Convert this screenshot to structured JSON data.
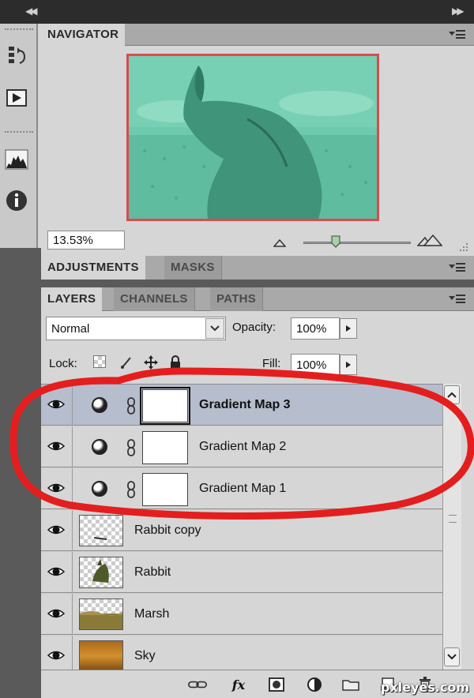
{
  "colors": {
    "preview_fill": "#6ec9ad",
    "preview_border": "#d84c4c",
    "selected_row": "#b6bdcc",
    "annotation": "#e41e1e"
  },
  "topbar": {
    "collapse_left_icon": "double-chevron-left-icon",
    "collapse_right_icon": "double-chevron-right-icon"
  },
  "navigator": {
    "tab": "NAVIGATOR",
    "zoom_value": "13.53%",
    "zoom_level": 0.35
  },
  "adjustments": {
    "tabs": [
      "ADJUSTMENTS",
      "MASKS"
    ]
  },
  "layers_panel": {
    "tabs": [
      "LAYERS",
      "CHANNELS",
      "PATHS"
    ],
    "blend_mode": "Normal",
    "opacity_label": "Opacity:",
    "opacity_value": "100%",
    "lock_label": "Lock:",
    "fill_label": "Fill:",
    "fill_value": "100%",
    "layers": [
      {
        "name": "Gradient Map 3",
        "type": "adjustment",
        "selected": true
      },
      {
        "name": "Gradient Map 2",
        "type": "adjustment",
        "selected": false
      },
      {
        "name": "Gradient Map 1",
        "type": "adjustment",
        "selected": false
      },
      {
        "name": "Rabbit copy",
        "type": "pixel",
        "selected": false
      },
      {
        "name": "Rabbit",
        "type": "pixel",
        "selected": false
      },
      {
        "name": "Marsh",
        "type": "pixel",
        "selected": false
      },
      {
        "name": "Sky",
        "type": "pixel",
        "selected": false
      }
    ],
    "footer_icons": [
      "link-layers-icon",
      "fx-icon",
      "add-mask-icon",
      "new-adjustment-icon",
      "new-group-icon",
      "new-layer-icon",
      "trash-icon"
    ],
    "fx_label": "fx"
  },
  "watermark": "pxleyes.com"
}
